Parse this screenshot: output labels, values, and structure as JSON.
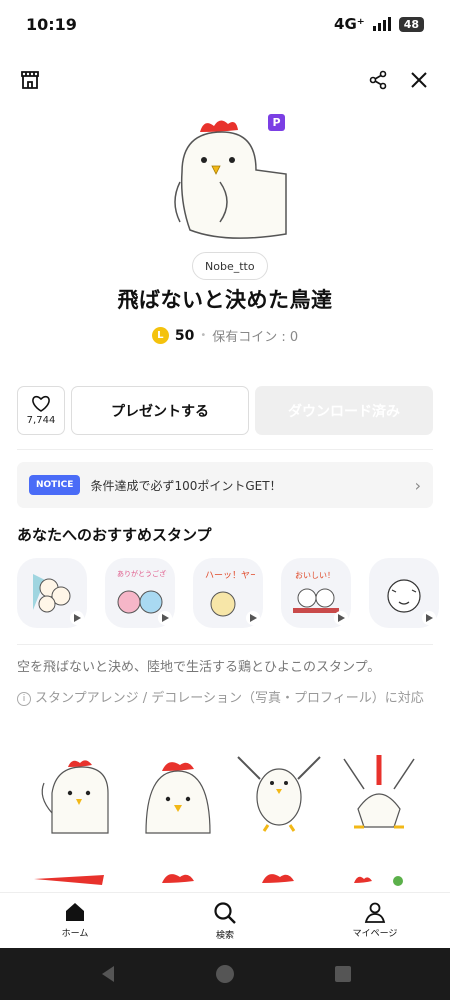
{
  "status": {
    "time": "10:19",
    "network": "4G⁺",
    "battery": "48"
  },
  "pack": {
    "badge": "P",
    "author": "Nobe_tto",
    "title": "飛ばないと決めた鳥達",
    "coin_symbol": "L",
    "price": "50",
    "owned_coins": "保有コイン : 0"
  },
  "actions": {
    "like_count": "7,744",
    "gift_label": "プレゼントする",
    "download_label": "ダウンロード済み"
  },
  "notice": {
    "badge": "NOTICE",
    "text": "条件達成で必ず100ポイントGET！"
  },
  "recommend": {
    "title": "あなたへのおすすめスタンプ",
    "items": [
      {
        "name": "stamp-cats-peek",
        "caption": ""
      },
      {
        "name": "stamp-arigatou",
        "caption": "ありがとうございまーす"
      },
      {
        "name": "stamp-haa",
        "caption": "ハーッ！ヤー"
      },
      {
        "name": "stamp-oishii",
        "caption": "おいしい！"
      },
      {
        "name": "stamp-tiger",
        "caption": ""
      }
    ]
  },
  "description": "空を飛ばないと決め、陸地で生活する鶏とひよこのスタンプ。",
  "arrange_note": "スタンプアレンジ / デコレーション（写真・プロフィール）に対応",
  "nav": {
    "home": "ホーム",
    "search": "検索",
    "mypage": "マイページ"
  },
  "colors": {
    "premium": "#7b3fe4",
    "notice": "#4a6cf7",
    "coin": "#f4c20d",
    "comb": "#e8322c",
    "beak": "#f2b817"
  }
}
